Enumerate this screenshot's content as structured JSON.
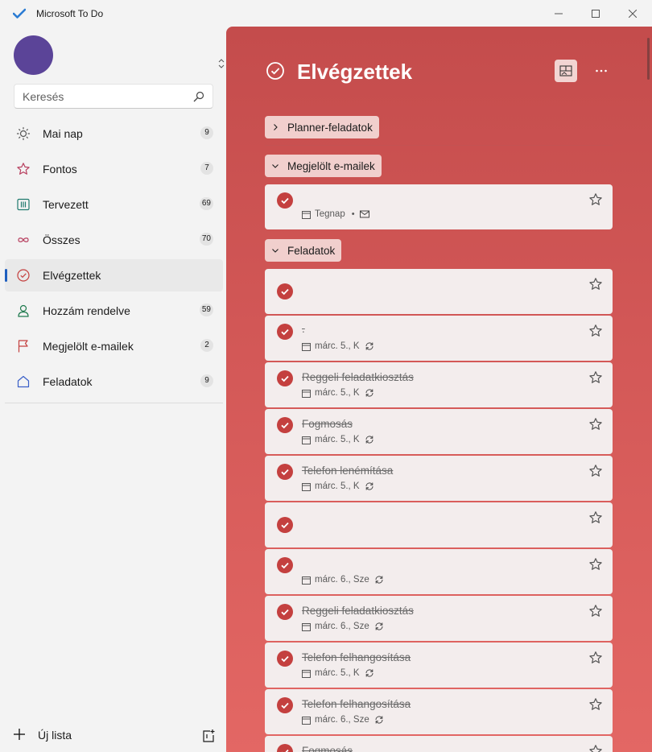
{
  "window": {
    "title": "Microsoft To Do"
  },
  "sidebar": {
    "search": {
      "placeholder": "Keresés"
    },
    "items": [
      {
        "label": "Mai nap",
        "count": "9",
        "icon": "sun-icon"
      },
      {
        "label": "Fontos",
        "count": "7",
        "icon": "star-icon"
      },
      {
        "label": "Tervezett",
        "count": "69",
        "icon": "calendar-grid-icon"
      },
      {
        "label": "Összes",
        "count": "70",
        "icon": "infinity-icon"
      },
      {
        "label": "Elvégzettek",
        "count": "",
        "icon": "check-circle-icon",
        "active": true
      },
      {
        "label": "Hozzám rendelve",
        "count": "59",
        "icon": "person-icon"
      },
      {
        "label": "Megjelölt e-mailek",
        "count": "2",
        "icon": "flag-icon"
      },
      {
        "label": "Feladatok",
        "count": "9",
        "icon": "home-icon"
      }
    ],
    "new_list_label": "Új lista"
  },
  "main": {
    "title": "Elvégzettek",
    "accent": "#c4403f",
    "groups": {
      "planner": {
        "label": "Planner-feladatok",
        "expanded": false
      },
      "flagged": {
        "label": "Megjelölt e-mailek",
        "expanded": true
      },
      "tasks": {
        "label": "Feladatok",
        "expanded": true
      }
    },
    "flagged_tasks": [
      {
        "title": "",
        "date": "Tegnap",
        "has_mail": true,
        "repeat": false
      }
    ],
    "tasks": [
      {
        "title": "",
        "date": "",
        "repeat": false
      },
      {
        "title": ".",
        "date": "márc. 5., K",
        "repeat": true
      },
      {
        "title": "Reggeli feladatkiosztás",
        "date": "márc. 5., K",
        "repeat": true
      },
      {
        "title": "Fogmosás",
        "date": "márc. 5., K",
        "repeat": true
      },
      {
        "title": "Telefon lenémítása",
        "date": "márc. 5., K",
        "repeat": true
      },
      {
        "title": "",
        "date": "",
        "repeat": false
      },
      {
        "title": "",
        "date": "márc. 6., Sze",
        "repeat": true
      },
      {
        "title": "Reggeli feladatkiosztás",
        "date": "márc. 6., Sze",
        "repeat": true
      },
      {
        "title": "Telefon felhangosítása",
        "date": "márc. 5., K",
        "repeat": true
      },
      {
        "title": "Telefon felhangosítása",
        "date": "márc. 6., Sze",
        "repeat": true
      },
      {
        "title": "Fogmosás",
        "date": "",
        "repeat": false
      }
    ]
  }
}
